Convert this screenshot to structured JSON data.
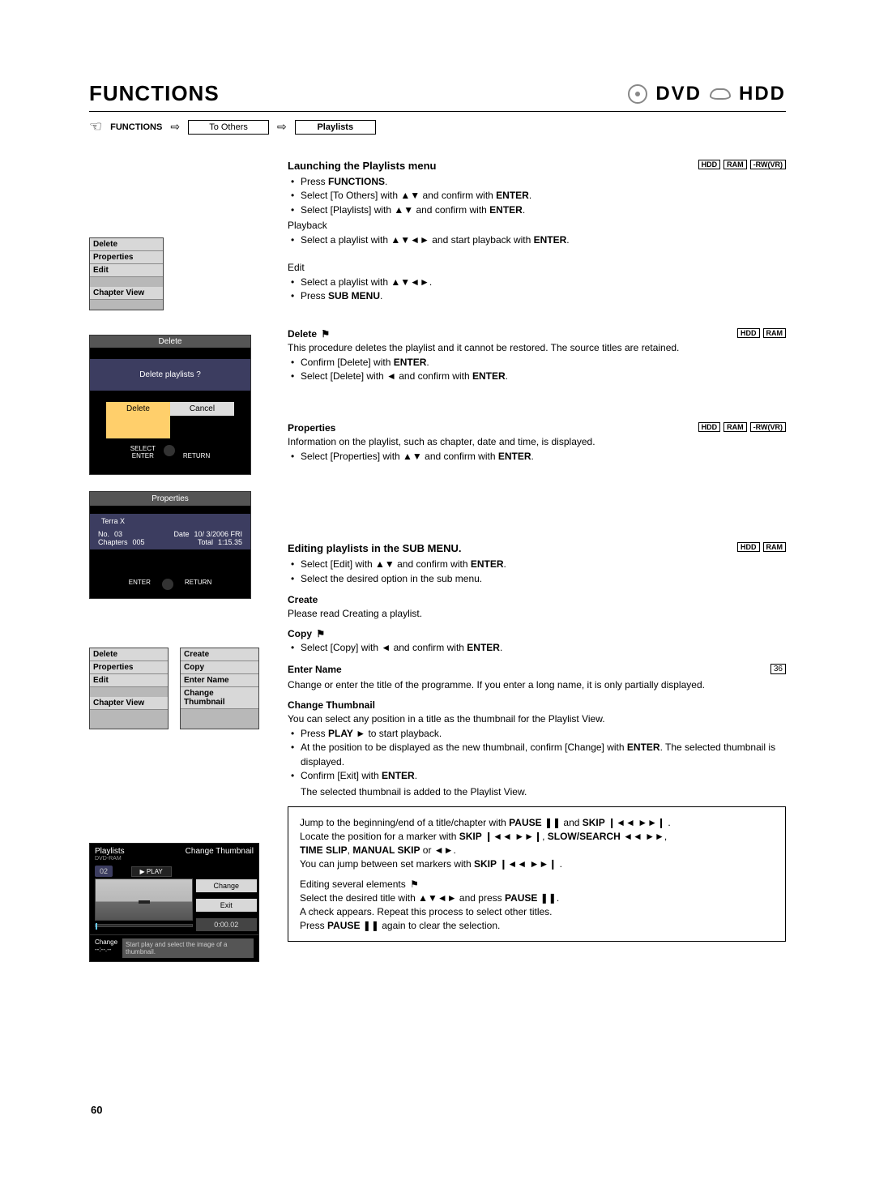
{
  "header": {
    "title": "FUNCTIONS",
    "media1": "DVD",
    "media2": "HDD"
  },
  "crumbs": {
    "label": "FUNCTIONS",
    "step1": "To Others",
    "step2": "Playlists"
  },
  "menuA": {
    "i0": "Delete",
    "i1": "Properties",
    "i2": "Edit",
    "i3": "Chapter View"
  },
  "deleteDlg": {
    "title": "Delete",
    "msg": "Delete playlists ?",
    "btn1": "Delete",
    "btn2": "Cancel",
    "foot1": "SELECT",
    "foot2": "ENTER",
    "foot3": "RETURN"
  },
  "propPanel": {
    "title": "Properties",
    "name": "Terra X",
    "noL": "No.",
    "noV": "03",
    "chL": "Chapters",
    "chV": "005",
    "dtL": "Date",
    "dtV": "10/ 3/2006 FRI",
    "toL": "Total",
    "toV": "1:15.35",
    "foot1": "ENTER",
    "foot2": "RETURN"
  },
  "menuB1": {
    "i0": "Delete",
    "i1": "Properties",
    "i2": "Edit",
    "i3": "Chapter View"
  },
  "menuB2": {
    "i0": "Create",
    "i1": "Copy",
    "i2": "Enter Name",
    "i3": "Change Thumbnail"
  },
  "thumb": {
    "hdrL1": "Playlists",
    "hdrL2": "DVD-RAM",
    "hdrR": "Change Thumbnail",
    "badge": "02",
    "play": "PLAY",
    "change": "Change",
    "exit": "Exit",
    "time": "0:00.02",
    "hintL1": "Change",
    "hintL2": "--:--.--",
    "hintR": "Start play and select the image of a thumbnail."
  },
  "tags": {
    "hdd": "HDD",
    "ram": "RAM",
    "rwvr": "-RW(VR)",
    "p36": "36"
  },
  "sec1": {
    "h": "Launching the Playlists menu",
    "b1a": "Press ",
    "b1b": "FUNCTIONS",
    "b1c": ".",
    "b2a": "Select [To Others] with ▲▼ and confirm with ",
    "b2b": "ENTER",
    "b2c": ".",
    "b3a": "Select [Playlists] with ▲▼ and confirm with ",
    "b3b": "ENTER",
    "b3c": ".",
    "pb": "Playback",
    "b4a": "Select a playlist with ▲▼◄► and start playback with ",
    "b4b": "ENTER",
    "b4c": ".",
    "ed": "Edit",
    "b5": "Select a playlist with ▲▼◄►.",
    "b6a": "Press ",
    "b6b": "SUB MENU",
    "b6c": "."
  },
  "sec2": {
    "h": "Delete",
    "p": "This procedure deletes the playlist and it cannot be restored. The source titles are retained.",
    "b1a": "Confirm [Delete] with ",
    "b1b": "ENTER",
    "b1c": ".",
    "b2a": "Select [Delete] with ◄ and confirm with ",
    "b2b": "ENTER",
    "b2c": "."
  },
  "sec3": {
    "h": "Properties",
    "p": "Information on the playlist, such as chapter, date and time, is displayed.",
    "b1a": "Select [Properties] with ▲▼ and confirm with ",
    "b1b": "ENTER",
    "b1c": "."
  },
  "sec4": {
    "h": "Editing playlists in the SUB MENU.",
    "b1a": "Select [Edit] with ▲▼ and confirm with ",
    "b1b": "ENTER",
    "b1c": ".",
    "b2": "Select the desired option in the sub menu.",
    "createH": "Create",
    "createP": "Please read Creating a playlist.",
    "copyH": "Copy",
    "copyB1a": "Select [Copy] with ◄ and confirm with ",
    "copyB1b": "ENTER",
    "copyB1c": ".",
    "enH": "Enter Name",
    "enP": "Change or enter the title of the programme. If you enter a long name, it is only partially displayed.",
    "ctH": "Change Thumbnail",
    "ctP": "You can select any position in a title as the thumbnail for the Playlist View.",
    "ct1a": "Press ",
    "ct1b": "PLAY",
    "ct1c": " ►  to start playback.",
    "ct2a": "At the position to be displayed as the new thumbnail, confirm [Change] with ",
    "ct2b": "ENTER",
    "ct2c": ". The selected thumbnail is displayed.",
    "ct3a": "Confirm [Exit] with ",
    "ct3b": "ENTER",
    "ct3c": ".",
    "ct4": "The selected thumbnail is added to the Playlist View."
  },
  "notebox": {
    "l1a": "Jump to the beginning/end of a title/chapter with ",
    "l1b": "PAUSE",
    "l1c": " ❚❚ and ",
    "l1d": "SKIP",
    "l1e": " ❙◄◄ ►►❙ .",
    "l2a": "Locate the position for a marker with ",
    "l2b": "SKIP",
    "l2c": " ❙◄◄ ►►❙, ",
    "l2d": "SLOW/SEARCH",
    "l2e": " ◄◄ ►►,",
    "l3a": "TIME SLIP",
    "l3b": ", ",
    "l3c": "MANUAL SKIP",
    "l3d": " or ◄►.",
    "l4a": "You can jump between set markers with ",
    "l4b": "SKIP",
    "l4c": " ❙◄◄ ►►❙ .",
    "l5": "Editing several elements",
    "l6a": "Select the desired title with ▲▼◄► and press ",
    "l6b": "PAUSE",
    "l6c": " ❚❚.",
    "l7": "A check appears. Repeat this process to select other titles.",
    "l8a": "Press ",
    "l8b": "PAUSE",
    "l8c": " ❚❚ again to clear the selection."
  },
  "pagenum": "60"
}
